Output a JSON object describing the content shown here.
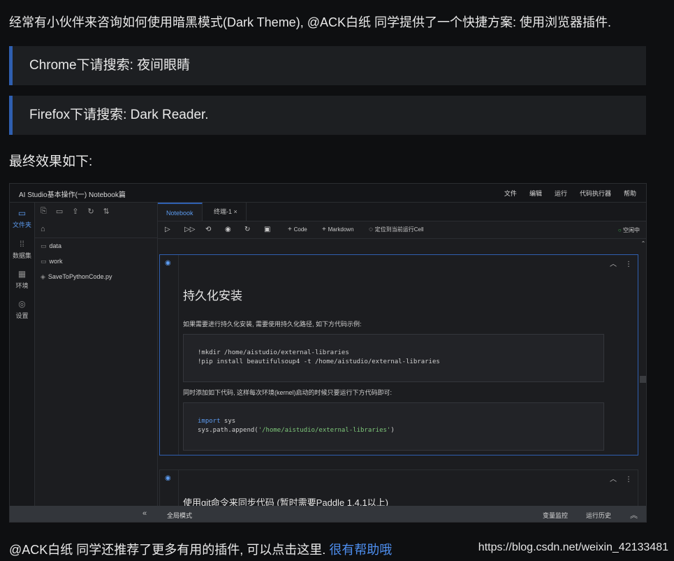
{
  "article": {
    "intro": "经常有小伙伴来咨询如何使用暗黑模式(Dark Theme), @ACK白纸 同学提供了一个快捷方案: 使用浏览器插件.",
    "quote_chrome": "Chrome下请搜索: 夜间眼睛",
    "quote_firefox": "Firefox下请搜索: Dark Reader.",
    "result_heading": "最终效果如下:",
    "outro_text": "@ACK白纸 同学还推荐了更多有用的插件, 可以点击这里.",
    "outro_link": "很有帮助哦",
    "watermark": "https://blog.csdn.net/weixin_42133481"
  },
  "screenshot": {
    "title": "AI Studio基本操作(一) Notebook篇",
    "menu": [
      "文件",
      "编辑",
      "运行",
      "代码执行器",
      "帮助"
    ],
    "leftbar": [
      {
        "label": "文件夹",
        "icon": "folder-icon"
      },
      {
        "label": "数据集",
        "icon": "dataset-icon"
      },
      {
        "label": "环境",
        "icon": "environment-icon"
      },
      {
        "label": "设置",
        "icon": "settings-icon"
      }
    ],
    "files": [
      {
        "name": "data",
        "icon": "folder-icon"
      },
      {
        "name": "work",
        "icon": "folder-icon"
      },
      {
        "name": "SaveToPythonCode.py",
        "icon": "python-file-icon"
      }
    ],
    "tabs": [
      "Notebook",
      "终端-1"
    ],
    "toolbar": {
      "add_code": "Code",
      "add_markdown": "Markdown",
      "locate_cell": "定位到当前运行Cell",
      "status": "空闲中"
    },
    "cell1": {
      "heading": "持久化安装",
      "text1": "如果需要进行持久化安装, 需要使用持久化路径, 如下方代码示例:",
      "code1_line1": "!mkdir /home/aistudio/external-libraries",
      "code1_line2": "!pip install beautifulsoup4 -t /home/aistudio/external-libraries",
      "text2": "同时添加如下代码, 这样每次环境(kernel)启动的时候只要运行下方代码即可:",
      "code2_kw": "import",
      "code2_mod": " sys",
      "code2_line2_a": "sys.path.append(",
      "code2_line2_str": "'/home/aistudio/external-libraries'",
      "code2_line2_b": ")"
    },
    "cell2": {
      "heading": "使用git命令来同步代码 (暂时需要Paddle 1.4.1以上)"
    },
    "bottom": {
      "global_mode": "全局模式",
      "variable_monitor": "变量监控",
      "run_history": "运行历史"
    }
  }
}
